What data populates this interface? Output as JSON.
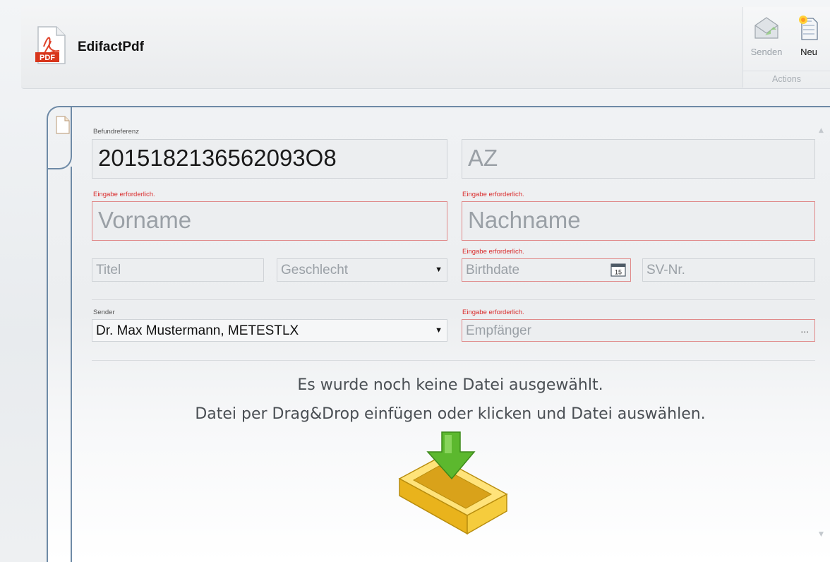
{
  "app": {
    "title": "EdifactPdf",
    "logo_icon": "pdf-icon"
  },
  "ribbon": {
    "send_label": "Senden",
    "new_label": "Neu",
    "group_label": "Actions"
  },
  "form": {
    "befundreferenz_label": "Befundreferenz",
    "befundreferenz_value": "2015182136562093O8",
    "az_placeholder": "AZ",
    "required_msg": "Eingabe erforderlich.",
    "vorname_placeholder": "Vorname",
    "nachname_placeholder": "Nachname",
    "titel_placeholder": "Titel",
    "geschlecht_placeholder": "Geschlecht",
    "birthdate_placeholder": "Birthdate",
    "calendar_day": "15",
    "svnr_placeholder": "SV-Nr.",
    "sender_label": "Sender",
    "sender_value": "Dr. Max Mustermann, METESTLX",
    "empfaenger_placeholder": "Empfänger",
    "empfaenger_button": "..."
  },
  "dropzone": {
    "line1": "Es wurde noch keine Datei ausgewählt.",
    "line2": "Datei per Drag&Drop einfügen oder klicken und Datei auswählen."
  },
  "colors": {
    "error": "#d92a2a",
    "accent_border": "#6e8aa6",
    "arrow_green": "#5cb82e",
    "tray_yellow": "#f2c531"
  }
}
